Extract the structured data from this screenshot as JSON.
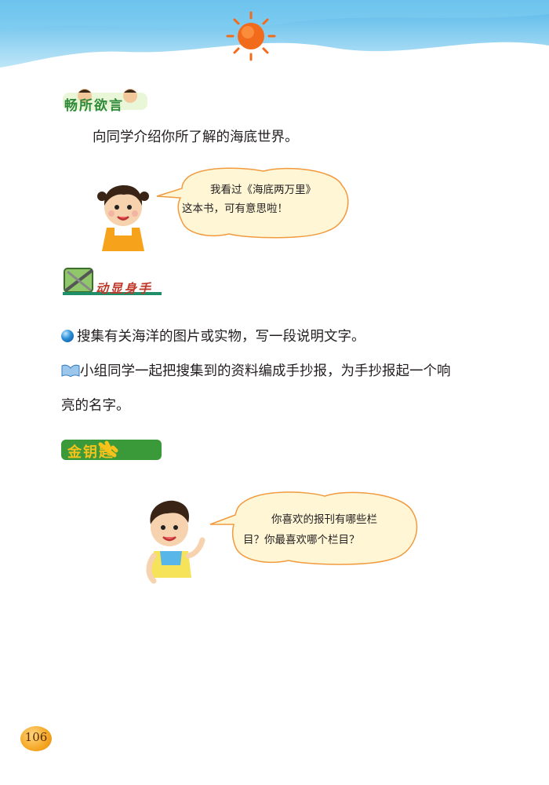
{
  "section1": {
    "badge_label": "畅所欲言",
    "prompt": "向同学介绍你所了解的海底世界。",
    "bubble_line1": "我看过《海底两万里》",
    "bubble_line2": "这本书，可有意思啦！"
  },
  "section2": {
    "badge_label": "动显身手",
    "item1": "搜集有关海洋的图片或实物，写一段说明文字。",
    "item2_line1": "小组同学一起把搜集到的资料编成手抄报，为手抄报起一个响",
    "item2_line2": "亮的名字。"
  },
  "section3": {
    "badge_label": "金钥匙",
    "bubble_line1": "你喜欢的报刊有哪些栏",
    "bubble_line2": "目？你最喜欢哪个栏目？"
  },
  "page_number": "106",
  "colors": {
    "sky_blue": "#6ec6ee",
    "sun_orange": "#f26b1d",
    "bubble_fill": "#fff6d6",
    "bubble_stroke": "#f19a3e",
    "badge_green": "#2f8a3a"
  }
}
